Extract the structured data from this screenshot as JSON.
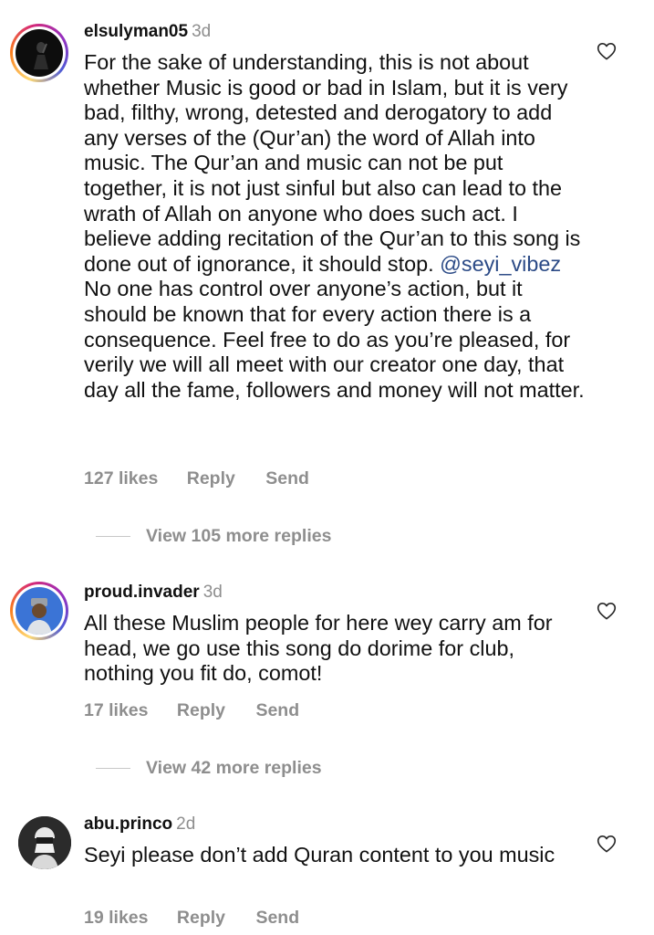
{
  "comments": [
    {
      "username": "elsulyman05",
      "age": "3d",
      "text_parts": [
        "For the sake of understanding, this is not about whether Music is good or bad in Islam, but it is very bad, filthy, wrong, detested and derogatory to add any verses of the (Qur’an) the word of Allah into music. The Qur’an and music can not be put together, it is not just sinful but also can lead to the wrath of Allah on anyone who does such act. I believe adding recitation of the Qur’an to this song is done out of ignorance, it should stop. ",
        "@seyi_vibez",
        " No one has control over anyone’s action, but it should be known that for every action there is a consequence. Feel free to do as you’re pleased, for verily we will all meet with our creator one day, that day all the fame, followers and money will not matter."
      ],
      "likes": "127 likes",
      "reply": "Reply",
      "send": "Send",
      "view_replies": "View 105 more replies"
    },
    {
      "username": "proud.invader",
      "age": "3d",
      "text": "All these Muslim people for here wey carry am for head, we go use this song do dorime for club, nothing you fit do, comot!",
      "likes": "17 likes",
      "reply": "Reply",
      "send": "Send",
      "view_replies": "View 42 more replies"
    },
    {
      "username": "abu.princo",
      "age": "2d",
      "text": "Seyi please don’t add Quran content to you music",
      "likes": "19 likes",
      "reply": "Reply",
      "send": "Send"
    }
  ],
  "icons": {
    "like": "heart-outline-icon"
  },
  "colors": {
    "mention": "#2b4a86",
    "meta": "#8e8e8e"
  }
}
